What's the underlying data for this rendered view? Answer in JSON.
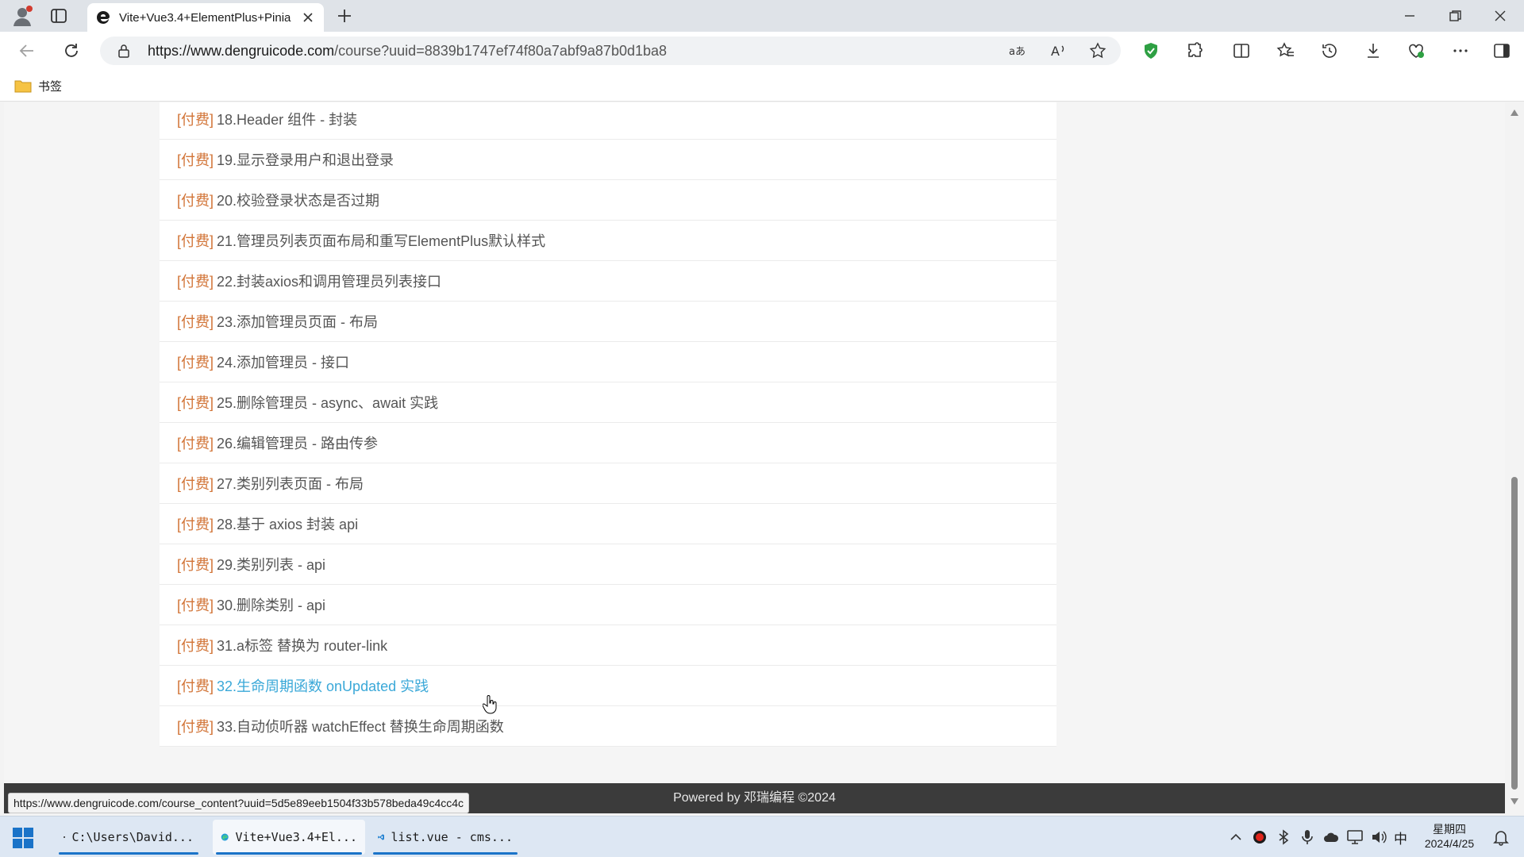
{
  "browser": {
    "tab_title": "Vite+Vue3.4+ElementPlus+Pinia",
    "url_domain": "https://www.dengruicode.com",
    "url_path": "/course?uuid=8839b1747ef74f80a7abf9a87b0d1ba8"
  },
  "bookmarks": {
    "folder_label": "书签"
  },
  "course_list": [
    {
      "tag": "[付费]",
      "title": "18.Header 组件 - 封装"
    },
    {
      "tag": "[付费]",
      "title": "19.显示登录用户和退出登录"
    },
    {
      "tag": "[付费]",
      "title": "20.校验登录状态是否过期"
    },
    {
      "tag": "[付费]",
      "title": "21.管理员列表页面布局和重写ElementPlus默认样式"
    },
    {
      "tag": "[付费]",
      "title": "22.封装axios和调用管理员列表接口"
    },
    {
      "tag": "[付费]",
      "title": "23.添加管理员页面 - 布局"
    },
    {
      "tag": "[付费]",
      "title": "24.添加管理员 - 接口"
    },
    {
      "tag": "[付费]",
      "title": "25.删除管理员 - async、await 实践"
    },
    {
      "tag": "[付费]",
      "title": "26.编辑管理员 - 路由传参"
    },
    {
      "tag": "[付费]",
      "title": "27.类别列表页面 - 布局"
    },
    {
      "tag": "[付费]",
      "title": "28.基于 axios 封装 api"
    },
    {
      "tag": "[付费]",
      "title": "29.类别列表 - api"
    },
    {
      "tag": "[付费]",
      "title": "30.删除类别 - api"
    },
    {
      "tag": "[付费]",
      "title": "31.a标签 替换为 router-link"
    },
    {
      "tag": "[付费]",
      "title": "32.生命周期函数 onUpdated 实践"
    },
    {
      "tag": "[付费]",
      "title": "33.自动侦听器 watchEffect 替换生命周期函数"
    }
  ],
  "footer": {
    "text": "Powered by 邓瑞编程 ©2024"
  },
  "status_bar": {
    "hover_url": "https://www.dengruicode.com/course_content?uuid=5d5e89eeb1504f33b578beda49c4cc4c"
  },
  "taskbar": {
    "apps": [
      {
        "label": "C:\\Users\\David..."
      },
      {
        "label": "Vite+Vue3.4+El..."
      },
      {
        "label": "list.vue - cms..."
      }
    ],
    "ime": "中",
    "clock_day": "星期四",
    "clock_date": "2024/4/25"
  },
  "colors": {
    "tag": "#d27437",
    "title": "#555555",
    "hover_link": "#3aa8d8",
    "footer_bg": "#3b3b3b"
  }
}
